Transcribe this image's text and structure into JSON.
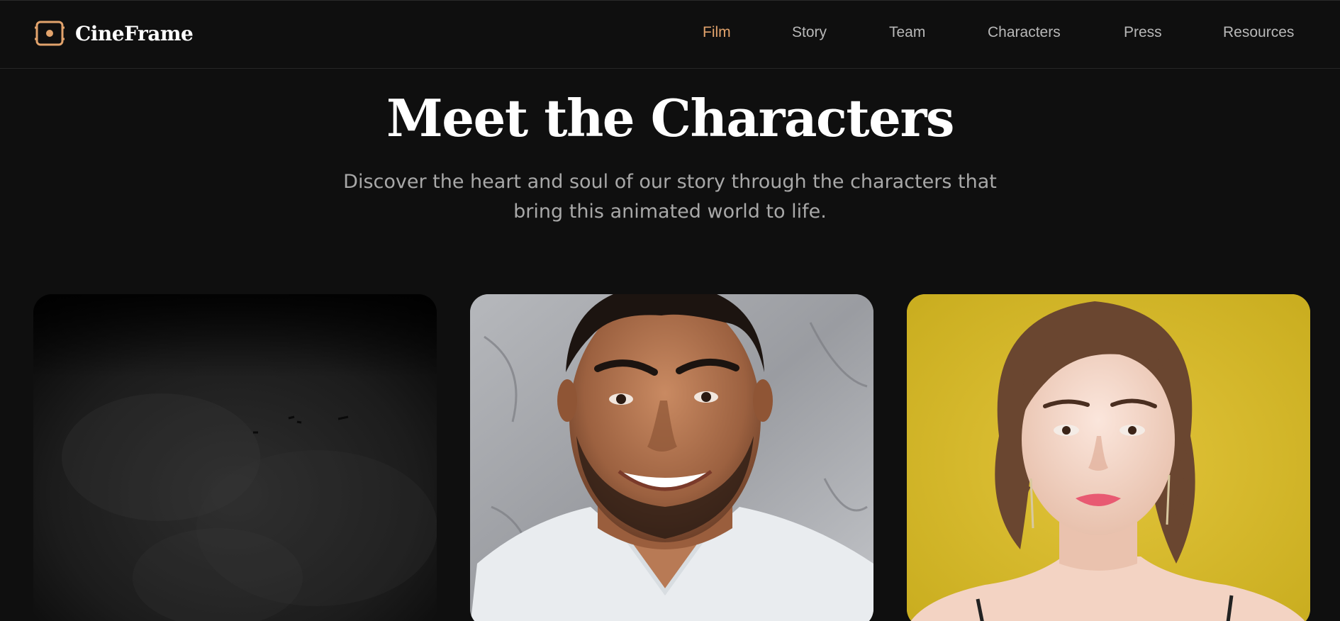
{
  "brand": {
    "name": "CineFrame",
    "accent": "#e2a36c"
  },
  "nav": {
    "items": [
      {
        "label": "Film",
        "active": true
      },
      {
        "label": "Story",
        "active": false
      },
      {
        "label": "Team",
        "active": false
      },
      {
        "label": "Characters",
        "active": false
      },
      {
        "label": "Press",
        "active": false
      },
      {
        "label": "Resources",
        "active": false
      }
    ]
  },
  "hero": {
    "title": "Meet the Characters",
    "subtitle_line1": "Discover the heart and soul of our story through the characters that",
    "subtitle_line2": "bring this animated world to life."
  },
  "cards": [
    {
      "image": "dark-textured-background"
    },
    {
      "image": "portrait-smiling-man-white-shirt"
    },
    {
      "image": "portrait-woman-yellow-background"
    }
  ]
}
